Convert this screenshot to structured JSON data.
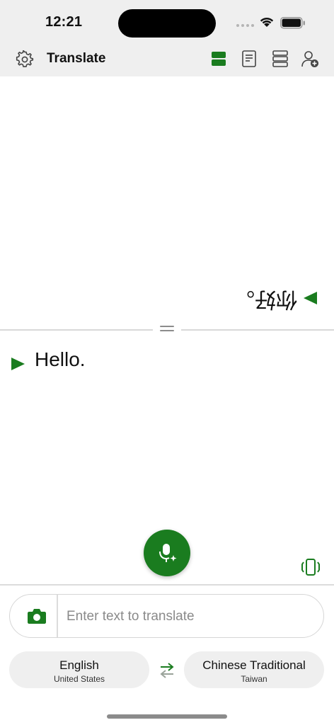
{
  "status_bar": {
    "time": "12:21"
  },
  "header": {
    "title": "Translate",
    "icons": [
      "gear-icon",
      "split-view-icon",
      "document-icon",
      "list-view-icon",
      "person-add-icon"
    ],
    "accent_color": "#1a7c1f"
  },
  "translation": {
    "translated_text": "你好。",
    "source_text": "Hello."
  },
  "input": {
    "placeholder": "Enter text to translate",
    "value": ""
  },
  "languages": {
    "source": {
      "name": "English",
      "region": "United States"
    },
    "target": {
      "name": "Chinese Traditional",
      "region": "Taiwan"
    }
  }
}
